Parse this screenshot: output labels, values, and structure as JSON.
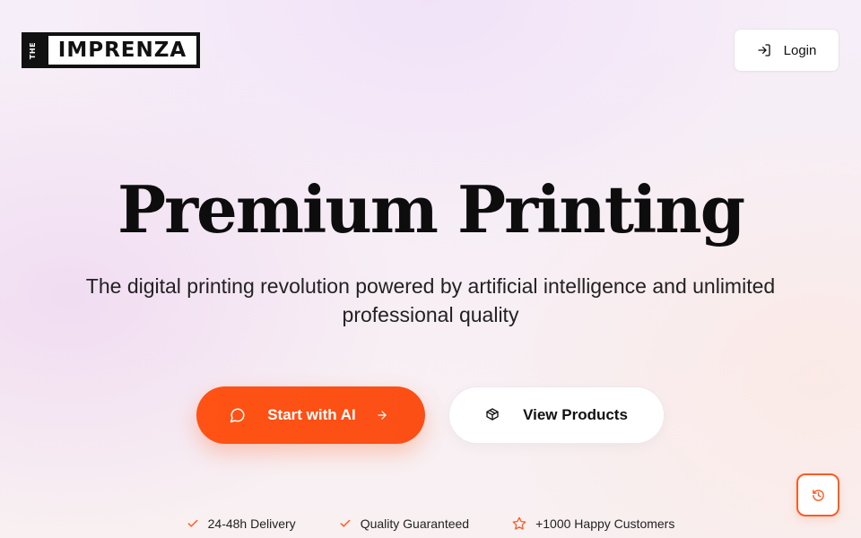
{
  "header": {
    "logo": {
      "small_text": "THE",
      "main_text": "IMPRENZA"
    },
    "login_label": "Login",
    "login_icon": "log-in-icon"
  },
  "hero": {
    "title": "Premium Printing",
    "subtitle": "The digital printing revolution powered by artificial intelligence and unlimited professional quality"
  },
  "actions": {
    "primary": {
      "label": "Start with AI",
      "icon_lead": "chat-bubble-icon",
      "icon_trail": "arrow-right-icon"
    },
    "secondary": {
      "label": "View Products",
      "icon": "package-icon"
    }
  },
  "floating": {
    "icon": "history-icon"
  },
  "features": [
    {
      "label": "24-48h Delivery",
      "icon": "check-icon"
    },
    {
      "label": "Quality Guaranteed",
      "icon": "check-icon"
    },
    {
      "label": "+1000 Happy Customers",
      "icon": "star-icon"
    }
  ],
  "colors": {
    "accent": "#FF5214",
    "text": "#111111",
    "button_bg": "#FFFFFF"
  }
}
